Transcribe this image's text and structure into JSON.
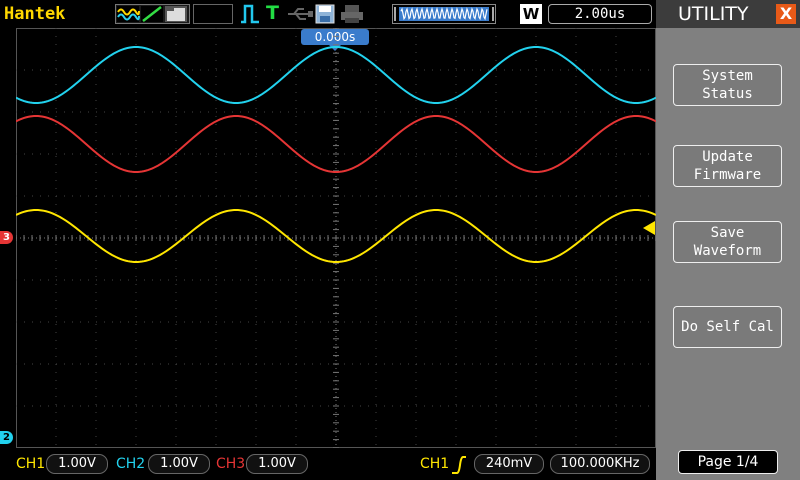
{
  "header": {
    "brand": "Hantek",
    "trigger_status": "T",
    "wave_icon": "W",
    "timebase": "2.00us",
    "trigger_position": "0.000s"
  },
  "markers": {
    "ch3": "3",
    "ch2": "2"
  },
  "channels": [
    {
      "label": "CH1",
      "value": "1.00V",
      "color": "#ffe600"
    },
    {
      "label": "CH2",
      "value": "1.00V",
      "color": "#22d2ee"
    },
    {
      "label": "CH3",
      "value": "1.00V",
      "color": "#e53535"
    }
  ],
  "trigger": {
    "source": "CH1",
    "level": "240mV",
    "frequency": "100.000KHz"
  },
  "utility_menu": {
    "title": "UTILITY",
    "close": "X",
    "items": [
      {
        "label": "System\nStatus"
      },
      {
        "label": "Update\nFirmware"
      },
      {
        "label": "Save\nWaveform"
      },
      {
        "label": "Do Self Cal"
      }
    ],
    "page": "Page 1/4"
  },
  "waveforms": [
    {
      "channel": "CH2",
      "color": "#22d2ee"
    },
    {
      "channel": "CH3",
      "color": "#e53535"
    },
    {
      "channel": "CH1",
      "color": "#ffe600"
    }
  ],
  "colors": {
    "brand": "#ffd800",
    "panel": "#808080",
    "trigger_marker": "#3a7ccc",
    "close": "#e85a18"
  }
}
